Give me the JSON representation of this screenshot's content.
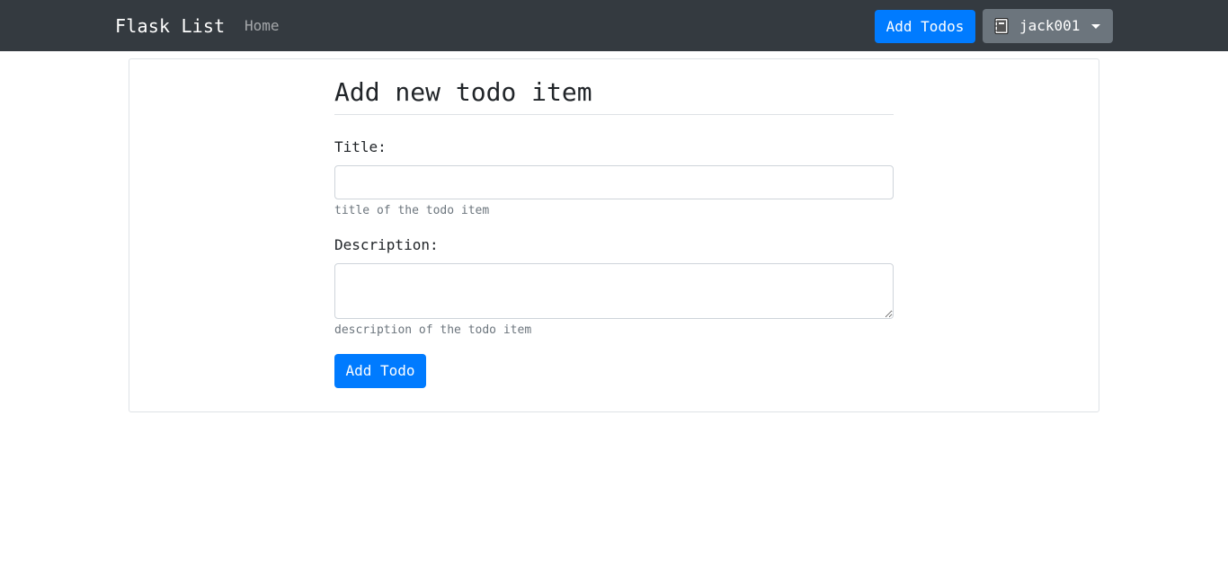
{
  "navbar": {
    "brand": "Flask List",
    "home_link": "Home",
    "add_todos_button": "Add Todos",
    "user_menu": {
      "icon": "notebook-icon",
      "username": "jack001"
    }
  },
  "form": {
    "heading": "Add new todo item",
    "title_label": "Title:",
    "title_value": "",
    "title_help": "title of the todo item",
    "description_label": "Description:",
    "description_value": "",
    "description_help": "description of the todo item",
    "submit_label": "Add Todo"
  },
  "colors": {
    "navbar_bg": "#343a40",
    "primary": "#007bff",
    "secondary": "#6c757d"
  }
}
